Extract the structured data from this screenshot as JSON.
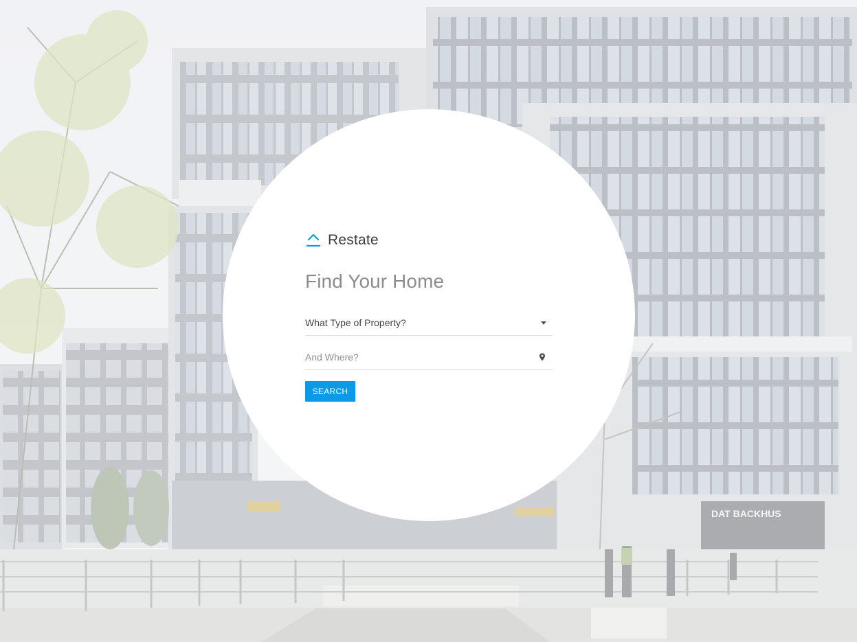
{
  "brand": {
    "name": "Restate",
    "icon": "house-roof-icon",
    "accent_color": "#0a9ae8"
  },
  "hero": {
    "title": "Find Your Home"
  },
  "form": {
    "property_type": {
      "value": "What Type of Property?",
      "icon": "chevron-down-icon"
    },
    "location": {
      "placeholder": "And Where?",
      "icon": "map-pin-icon"
    },
    "search_label": "SEARCH"
  },
  "background": {
    "sign_text": "DAT BACKHUS"
  }
}
